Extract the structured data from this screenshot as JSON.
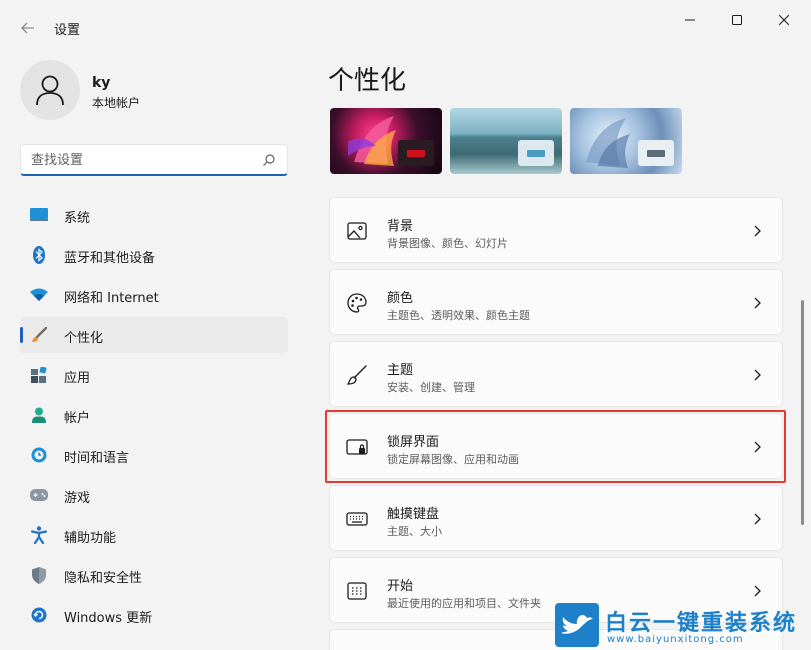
{
  "window": {
    "title": "设置",
    "controls": {
      "minimize": "minimize-icon",
      "maximize": "maximize-icon",
      "close": "close-icon"
    }
  },
  "user": {
    "name": "ky",
    "account_type": "本地帐户"
  },
  "search": {
    "placeholder": "查找设置"
  },
  "nav": {
    "items": [
      {
        "label": "系统",
        "icon": "system-display-icon",
        "active": false
      },
      {
        "label": "蓝牙和其他设备",
        "icon": "bluetooth-icon",
        "active": false
      },
      {
        "label": "网络和 Internet",
        "icon": "wifi-icon",
        "active": false
      },
      {
        "label": "个性化",
        "icon": "paintbrush-icon",
        "active": true
      },
      {
        "label": "应用",
        "icon": "apps-icon",
        "active": false
      },
      {
        "label": "帐户",
        "icon": "account-icon",
        "active": false
      },
      {
        "label": "时间和语言",
        "icon": "globe-clock-icon",
        "active": false
      },
      {
        "label": "游戏",
        "icon": "gamepad-icon",
        "active": false
      },
      {
        "label": "辅助功能",
        "icon": "accessibility-icon",
        "active": false
      },
      {
        "label": "隐私和安全性",
        "icon": "shield-icon",
        "active": false
      },
      {
        "label": "Windows 更新",
        "icon": "update-icon",
        "active": false
      }
    ]
  },
  "main": {
    "title": "个性化",
    "themes": [
      {
        "name": "glow",
        "chip_bar_color": "#d0101c"
      },
      {
        "name": "lake",
        "chip_bar_color": "#4a9cc0"
      },
      {
        "name": "bloom",
        "chip_bar_color": "#5e6b7a"
      }
    ],
    "cards": [
      {
        "title": "背景",
        "subtitle": "背景图像、颜色、幻灯片",
        "icon": "picture-icon"
      },
      {
        "title": "颜色",
        "subtitle": "主题色、透明效果、颜色主题",
        "icon": "palette-icon"
      },
      {
        "title": "主题",
        "subtitle": "安装、创建、管理",
        "icon": "brush-icon"
      },
      {
        "title": "锁屏界面",
        "subtitle": "锁定屏幕图像、应用和动画",
        "icon": "lock-screen-icon",
        "highlighted": true
      },
      {
        "title": "触摸键盘",
        "subtitle": "主题、大小",
        "icon": "keyboard-icon"
      },
      {
        "title": "开始",
        "subtitle": "最近使用的应用和项目、文件夹",
        "icon": "start-menu-icon"
      }
    ]
  },
  "watermark": {
    "name": "白云一键重装系统",
    "url": "www.baiyunxitong.com"
  },
  "colors": {
    "accent": "#1f5fb6",
    "highlight": "#e53935",
    "watermark": "#1e80c9"
  }
}
